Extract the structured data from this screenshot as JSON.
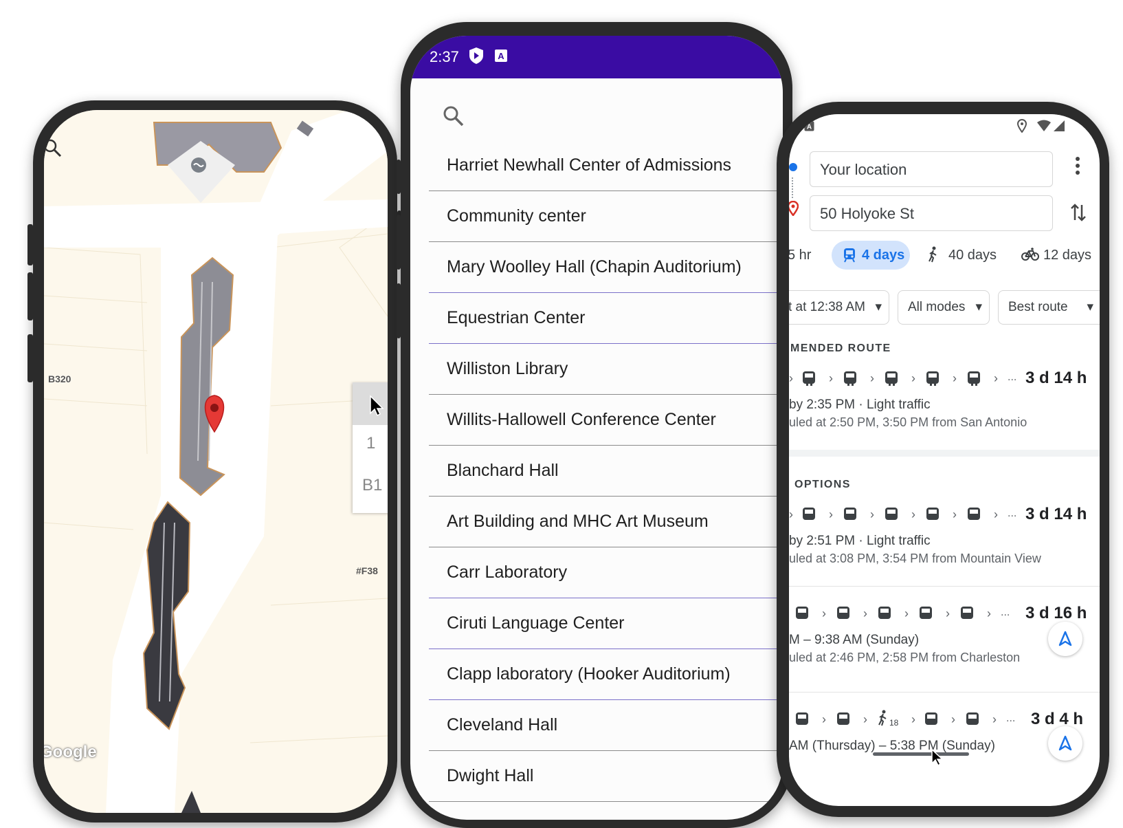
{
  "colors": {
    "status_bar": "#3a0ca3",
    "accent_blue": "#1a73e8",
    "pin_red": "#e53935",
    "map_base": "#fdf8ec",
    "path_white": "#ffffff",
    "building_gray": "#8d8d95"
  },
  "map": {
    "room_label_1": "B320",
    "room_label_2": "#F38",
    "floor_selector": [
      "1",
      "B1"
    ],
    "google_watermark": "Google"
  },
  "list_screen": {
    "status_time": "2:37",
    "search_icon": "search-icon",
    "items": [
      "Harriet Newhall Center of Admissions",
      "Community center",
      "Mary Woolley Hall (Chapin Auditorium)",
      "Equestrian Center",
      "Williston Library",
      "Willits-Hallowell Conference Center",
      "Blanchard Hall",
      "Art Building and MHC Art Museum",
      "Carr Laboratory",
      "Ciruti Language Center",
      "Clapp laboratory (Hooker Auditorium)",
      "Cleveland Hall",
      "Dwight Hall"
    ]
  },
  "directions": {
    "origin": "Your location",
    "destination": "50 Holyoke St",
    "modes": {
      "drive": "5 hr",
      "transit": "4 days",
      "walk": "40 days",
      "bike": "12 days"
    },
    "filters": {
      "depart": "t at 12:38 AM",
      "modes": "All modes",
      "route": "Best route"
    },
    "recommended_title": "MENDED ROUTE",
    "other_title": "OPTIONS",
    "routes": [
      {
        "duration": "3 d 14 h",
        "line1": "by 2:35 PM · Light traffic",
        "line2": "uled at 2:50 PM, 3:50 PM from San Antonio"
      },
      {
        "duration": "3 d 14 h",
        "line1": "by 2:51 PM · Light traffic",
        "line2": "uled at 3:08 PM, 3:54 PM from Mountain View"
      },
      {
        "duration": "3 d 16 h",
        "line1": "M – 9:38 AM (Sunday)",
        "line2": "uled at 2:46 PM, 2:58 PM from Charleston"
      },
      {
        "duration": "3 d 4 h",
        "line1": "AM (Thursday) – 5:38 PM (Sunday)",
        "line2": ""
      }
    ],
    "walk_minutes_badge": "18",
    "ellipsis": "..."
  }
}
